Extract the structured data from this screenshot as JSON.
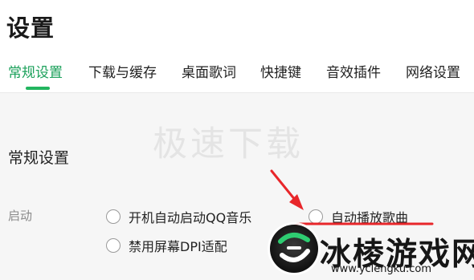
{
  "page": {
    "title": "设置"
  },
  "tabs": [
    {
      "label": "常规设置",
      "active": true
    },
    {
      "label": "下载与缓存",
      "active": false
    },
    {
      "label": "桌面歌词",
      "active": false
    },
    {
      "label": "快捷键",
      "active": false
    },
    {
      "label": "音效插件",
      "active": false
    },
    {
      "label": "网络设置",
      "active": false
    }
  ],
  "watermark": {
    "text": "极速下载"
  },
  "section": {
    "title": "常规设置"
  },
  "startup": {
    "label": "启动",
    "options": [
      {
        "label": "开机自动启动QQ音乐",
        "checked": false
      },
      {
        "label": "自动播放歌曲",
        "checked": false
      },
      {
        "label": "禁用屏幕DPI适配",
        "checked": false
      }
    ]
  },
  "overlay_logo": {
    "text": "冰棱游戏网",
    "url": "www.yclengku.com"
  },
  "colors": {
    "accent": "#1aa05a",
    "annotation_red": "#e8262a",
    "muted": "#8a8a8a"
  }
}
